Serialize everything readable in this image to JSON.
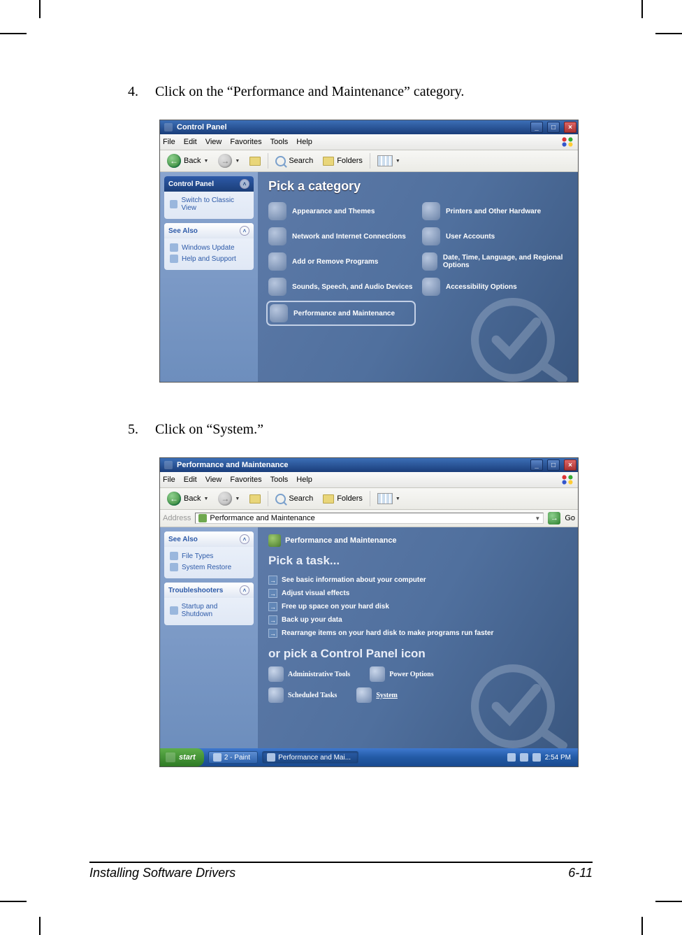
{
  "steps": {
    "s4": {
      "num": "4.",
      "text": "Click on the “Performance and Maintenance” category."
    },
    "s5": {
      "num": "5.",
      "text": "Click on “System.”"
    }
  },
  "ss_common": {
    "menu": {
      "file": "File",
      "edit": "Edit",
      "view": "View",
      "fav": "Favorites",
      "tools": "Tools",
      "help": "Help"
    },
    "toolbar": {
      "back": "Back",
      "search": "Search",
      "folders": "Folders"
    },
    "winbtns": {
      "min": "_",
      "max": "□",
      "close": "×"
    }
  },
  "ss1": {
    "title": "Control Panel",
    "sidebar": {
      "cp_header": "Control Panel",
      "switch": "Switch to Classic View",
      "see_also": "See Also",
      "items": [
        {
          "label": "Windows Update"
        },
        {
          "label": "Help and Support"
        }
      ]
    },
    "heading": "Pick a category",
    "categories": [
      {
        "label": "Appearance and Themes"
      },
      {
        "label": "Printers and Other Hardware"
      },
      {
        "label": "Network and Internet Connections"
      },
      {
        "label": "User Accounts"
      },
      {
        "label": "Add or Remove Programs"
      },
      {
        "label": "Date, Time, Language, and Regional Options"
      },
      {
        "label": "Sounds, Speech, and Audio Devices"
      },
      {
        "label": "Accessibility Options"
      },
      {
        "label": "Performance and Maintenance"
      }
    ]
  },
  "ss2": {
    "title": "Performance and Maintenance",
    "address": {
      "label": "Address",
      "value": "Performance and Maintenance",
      "go": "Go"
    },
    "sidebar": {
      "see_also": "See Also",
      "see_also_items": [
        {
          "label": "File Types"
        },
        {
          "label": "System Restore"
        }
      ],
      "troubleshooters": "Troubleshooters",
      "ts_items": [
        {
          "label": "Startup and Shutdown"
        }
      ]
    },
    "banner": "Performance and Maintenance",
    "heading_task": "Pick a task...",
    "tasks": [
      {
        "label": "See basic information about your computer"
      },
      {
        "label": "Adjust visual effects"
      },
      {
        "label": "Free up space on your hard disk"
      },
      {
        "label": "Back up your data"
      },
      {
        "label": "Rearrange items on your hard disk to make programs run faster"
      }
    ],
    "heading_icon": "or pick a Control Panel icon",
    "icons": [
      {
        "label": "Administrative Tools"
      },
      {
        "label": "Power Options"
      },
      {
        "label": "Scheduled Tasks"
      },
      {
        "label": "System"
      }
    ],
    "taskbar": {
      "start": "start",
      "items": [
        {
          "label": "2 - Paint"
        },
        {
          "label": "Performance and Mai..."
        }
      ],
      "time": "2:54 PM"
    }
  },
  "footer": {
    "left": "Installing Software Drivers",
    "right": "6-11"
  }
}
